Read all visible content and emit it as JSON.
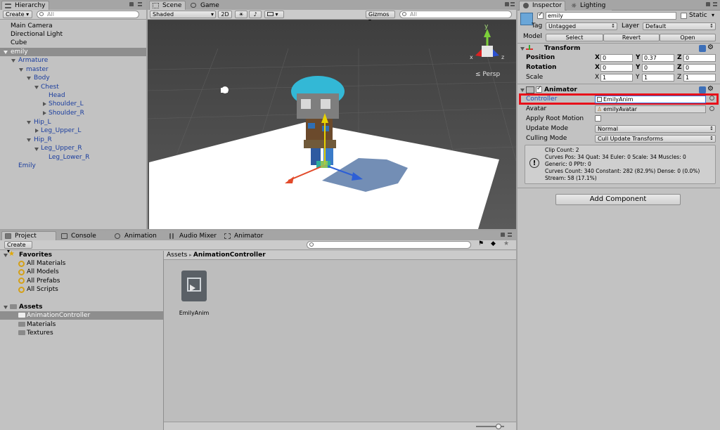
{
  "hierarchy": {
    "tab": "Hierarchy",
    "create": "Create",
    "search_placeholder": "All",
    "items": [
      "Main Camera",
      "Directional Light",
      "Cube",
      "emily",
      "Armature",
      "master",
      "Body",
      "Chest",
      "Head",
      "Shoulder_L",
      "Shoulder_R",
      "Hip_L",
      "Leg_Upper_L",
      "Hip_R",
      "Leg_Upper_R",
      "Leg_Lower_R",
      "Emily"
    ]
  },
  "scene": {
    "tabs": [
      "Scene",
      "Game"
    ],
    "shading": "Shaded",
    "mode2d": "2D",
    "gizmos": "Gizmos",
    "search_placeholder": "All",
    "persp": "Persp",
    "gizmo_axes": [
      "y",
      "x",
      "z"
    ]
  },
  "inspector": {
    "tabs": [
      "Inspector",
      "Lighting"
    ],
    "object_name": "emily",
    "static_label": "Static",
    "tag_label": "Tag",
    "tag_value": "Untagged",
    "layer_label": "Layer",
    "layer_value": "Default",
    "model_label": "Model",
    "model_buttons": [
      "Select",
      "Revert",
      "Open"
    ],
    "transform": {
      "title": "Transform",
      "position_label": "Position",
      "rotation_label": "Rotation",
      "scale_label": "Scale",
      "axis_labels": [
        "X",
        "Y",
        "Z"
      ],
      "position": [
        "0",
        "0.37",
        "0"
      ],
      "rotation": [
        "0",
        "0",
        "0"
      ],
      "scale": [
        "1",
        "1",
        "1"
      ]
    },
    "animator": {
      "title": "Animator",
      "controller_label": "Controller",
      "controller_value": "EmilyAnim",
      "avatar_label": "Avatar",
      "avatar_value": "emilyAvatar",
      "root_motion_label": "Apply Root Motion",
      "update_mode_label": "Update Mode",
      "update_mode_value": "Normal",
      "culling_mode_label": "Culling Mode",
      "culling_mode_value": "Cull Update Transforms",
      "info": [
        "Clip Count: 2",
        "Curves Pos: 34 Quat: 34 Euler: 0 Scale: 34 Muscles: 0",
        "Generic: 0 PPtr: 0",
        "Curves Count: 340 Constant: 282 (82.9%) Dense: 0 (0.0%)",
        "Stream: 58 (17.1%)"
      ]
    },
    "add_component": "Add Component",
    "highlight_color": "#e8101a"
  },
  "project": {
    "tabs": [
      "Project",
      "Console",
      "Animation",
      "Audio Mixer",
      "Animator"
    ],
    "create": "Create",
    "favorites_label": "Favorites",
    "favorites": [
      "All Materials",
      "All Models",
      "All Prefabs",
      "All Scripts"
    ],
    "assets_label": "Assets",
    "folders": [
      "AnimationController",
      "Materials",
      "Textures"
    ],
    "breadcrumb": [
      "Assets",
      "AnimationController"
    ],
    "asset_name": "EmilyAnim"
  }
}
